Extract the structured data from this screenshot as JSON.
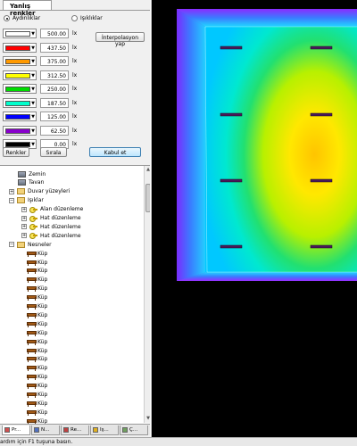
{
  "panel": {
    "title": "Yanlış renkler",
    "radio_illuminance": "Aydınlıklar",
    "radio_luminance": "Işıklıklar"
  },
  "legend": [
    {
      "color": "#ffffff",
      "value": "500.00",
      "unit": "lx"
    },
    {
      "color": "#ff0000",
      "value": "437.50",
      "unit": "lx"
    },
    {
      "color": "#ff9900",
      "value": "375.00",
      "unit": "lx"
    },
    {
      "color": "#ffff00",
      "value": "312.50",
      "unit": "lx"
    },
    {
      "color": "#00dd00",
      "value": "250.00",
      "unit": "lx"
    },
    {
      "color": "#00ffcc",
      "value": "187.50",
      "unit": "lx"
    },
    {
      "color": "#0000ff",
      "value": "125.00",
      "unit": "lx"
    },
    {
      "color": "#8800cc",
      "value": "62.50",
      "unit": "lx"
    },
    {
      "color": "#000000",
      "value": "0.00",
      "unit": "lx"
    }
  ],
  "buttons": {
    "interpolate": "İnterpolasyon yap",
    "colors": "Renkler",
    "sort": "Sırala",
    "accept": "Kabul et"
  },
  "tree": [
    {
      "label": "Zemin",
      "icon": "surface-icon"
    },
    {
      "label": "Tavan",
      "icon": "surface-icon"
    },
    {
      "label": "Duvar yüzeyleri",
      "icon": "folder-icon"
    },
    {
      "label": "Işıklar",
      "icon": "folder-icon"
    },
    {
      "label": "Alan düzenleme",
      "icon": "light-icon"
    },
    {
      "label": "Hat düzenleme",
      "icon": "light-icon"
    },
    {
      "label": "Hat düzenleme",
      "icon": "light-icon"
    },
    {
      "label": "Hat düzenleme",
      "icon": "light-icon"
    },
    {
      "label": "Nesneler",
      "icon": "folder-icon"
    },
    {
      "label": "Küp",
      "icon": "table-icon"
    },
    {
      "label": "Küp",
      "icon": "table-icon"
    },
    {
      "label": "Küp",
      "icon": "table-icon"
    },
    {
      "label": "Küp",
      "icon": "table-icon"
    },
    {
      "label": "Küp",
      "icon": "table-icon"
    },
    {
      "label": "Küp",
      "icon": "table-icon"
    },
    {
      "label": "Küp",
      "icon": "table-icon"
    },
    {
      "label": "Küp",
      "icon": "table-icon"
    },
    {
      "label": "Küp",
      "icon": "table-icon"
    },
    {
      "label": "Küp",
      "icon": "table-icon"
    },
    {
      "label": "Küp",
      "icon": "table-icon"
    },
    {
      "label": "Küp",
      "icon": "table-icon"
    },
    {
      "label": "Küp",
      "icon": "table-icon"
    },
    {
      "label": "Küp",
      "icon": "table-icon"
    },
    {
      "label": "Küp",
      "icon": "table-icon"
    },
    {
      "label": "Küp",
      "icon": "table-icon"
    },
    {
      "label": "Küp",
      "icon": "table-icon"
    },
    {
      "label": "Küp",
      "icon": "table-icon"
    },
    {
      "label": "Küp",
      "icon": "table-icon"
    },
    {
      "label": "Küp",
      "icon": "table-icon"
    }
  ],
  "tabs": [
    {
      "label": "Pr..."
    },
    {
      "label": "N..."
    },
    {
      "label": "Re..."
    },
    {
      "label": "Iş..."
    },
    {
      "label": "Ç..."
    }
  ],
  "status": "ardım için F1 tuşuna basın."
}
